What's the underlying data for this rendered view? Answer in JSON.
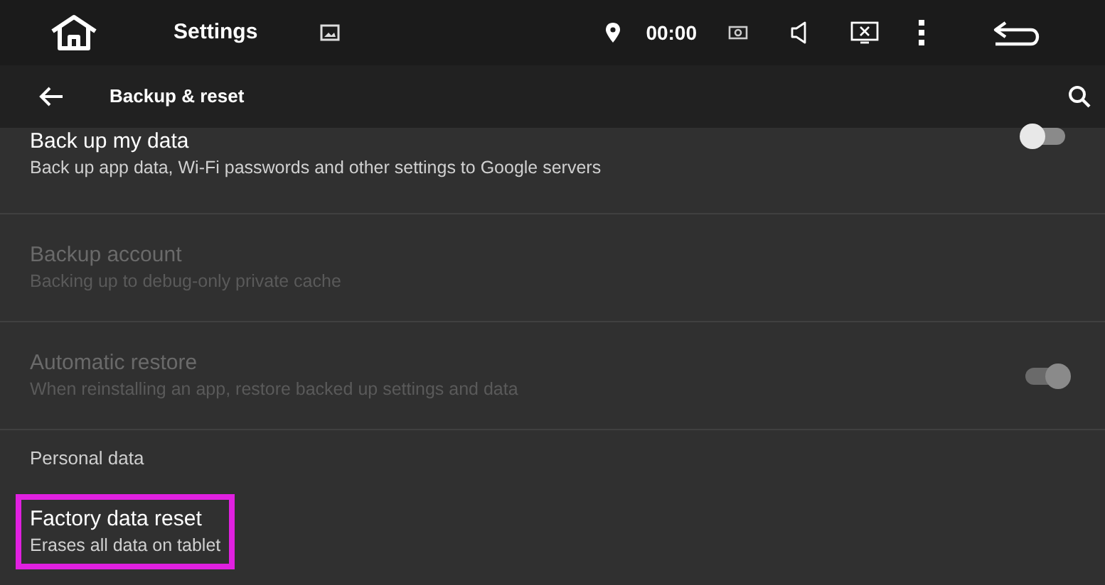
{
  "status_bar": {
    "title": "Settings",
    "time": "00:00"
  },
  "toolbar": {
    "title": "Backup & reset"
  },
  "items": [
    {
      "kind": "switch",
      "title": "Back up my data",
      "summary": "Back up app data, Wi-Fi passwords and other settings to Google servers",
      "disabled": false,
      "on": false,
      "highlighted": false
    },
    {
      "kind": "plain",
      "title": "Backup account",
      "summary": "Backing up to debug-only private cache",
      "disabled": true,
      "highlighted": false
    },
    {
      "kind": "switch",
      "title": "Automatic restore",
      "summary": "When reinstalling an app, restore backed up settings and data",
      "disabled": true,
      "on": true,
      "highlighted": false
    },
    {
      "kind": "header",
      "title": "Personal data"
    },
    {
      "kind": "plain",
      "title": "Factory data reset",
      "summary": "Erases all data on tablet",
      "disabled": false,
      "highlighted": true
    }
  ]
}
